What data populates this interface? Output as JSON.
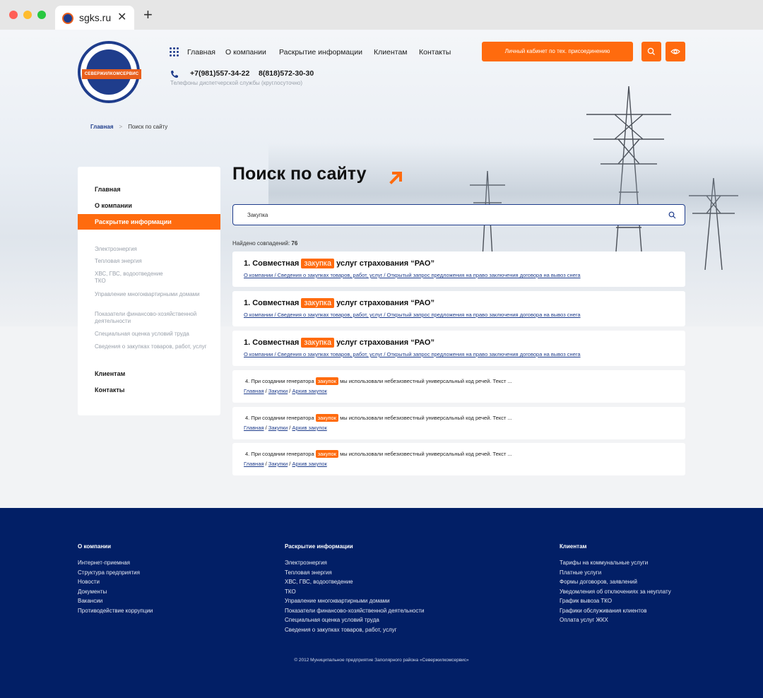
{
  "browser": {
    "tab_title": "sgks.ru",
    "close_glyph": "✕",
    "new_tab_glyph": "+"
  },
  "header": {
    "nav": [
      "Главная",
      "О компании",
      "Раскрытие информации",
      "Клиентам",
      "Контакты"
    ],
    "phones": [
      "+7(981)557-34-22",
      "8(818)572-30-30"
    ],
    "phones_caption": "Телефоны диспетчерской службы (круглосуточно)",
    "cabinet_button": "Личный кабинет по тех. присоединению",
    "logo_band_text": "СЕВЕРЖИЛКОМСЕРВИС"
  },
  "breadcrumb": {
    "home": "Главная",
    "separator": ">",
    "current": "Поиск по сайту"
  },
  "sidebar": {
    "top": [
      "Главная",
      "О компании"
    ],
    "active": "Раскрытие информации",
    "sub": [
      "Электроэнергия",
      "Тепловая энергия",
      "ХВС, ГВС, водоотведение\nТКО",
      "Управление многоквартирными домами",
      "Показатели финансово-хозяйственной деятельности",
      "Специальная оценка условий труда",
      "Сведения о закупках товаров, работ, услуг"
    ],
    "bottom": [
      "Клиентам",
      "Контакты"
    ]
  },
  "search": {
    "page_title": "Поиск по сайту",
    "query": "Закупка",
    "found_label": "Найдено совпадений:",
    "found_count": "76"
  },
  "results_big": [
    {
      "prefix": "1. Совместная",
      "highlight": "закупка",
      "suffix": "услуг страхования “РАО”",
      "path": "О компании / Сведения о закупках товаров, работ, услуг / Открытый запрос предложения на право заключения договора на вывоз снега"
    },
    {
      "prefix": "1. Совместная",
      "highlight": "закупка",
      "suffix": "услуг страхования “РАО”",
      "path": "О компании / Сведения о закупках товаров, работ, услуг / Открытый запрос предложения на право заключения договора на вывоз снега"
    },
    {
      "prefix": "1. Совместная",
      "highlight": "закупка",
      "suffix": "услуг страхования “РАО”",
      "path": "О компании / Сведения о закупках товаров, работ, услуг / Открытый запрос предложения на право заключения договора на вывоз снега"
    }
  ],
  "results_small": [
    {
      "prefix": "4.   При создании генератора",
      "highlight": "закупок",
      "suffix": "мы использовали небезизвестный универсальный код речей. Текст ...",
      "links": [
        "Главная",
        "Закупки",
        "Архив закупок"
      ]
    },
    {
      "prefix": "4.   При создании генератора",
      "highlight": "закупок",
      "suffix": "мы использовали небезизвестный универсальный код речей. Текст ...",
      "links": [
        "Главная",
        "Закупки",
        "Архив закупок"
      ]
    },
    {
      "prefix": "4.   При создании генератора",
      "highlight": "закупок",
      "suffix": "мы использовали небезизвестный универсальный код речей. Текст ...",
      "links": [
        "Главная",
        "Закупки",
        "Архив закупок"
      ]
    }
  ],
  "footer": {
    "col1": {
      "head": "О компании",
      "links": [
        "Интернет-приемная",
        "Структура предприятия",
        "Новости",
        "Документы",
        "Вакансии",
        "Противодействие коррупции"
      ]
    },
    "col2": {
      "head": "Раскрытие информации",
      "links": [
        "Электроэнергия",
        "Тепловая энергия",
        "ХВС, ГВС, водоотведение",
        "ТКО",
        "Управление многоквартирными домами",
        "Показатели финансово-хозяйственной деятельности",
        "Специальная оценка условий труда",
        "Сведения о закупках товаров, работ, услуг"
      ]
    },
    "col3": {
      "head": "Клиентам",
      "links": [
        "Тарифы на коммунальные услуги",
        "Платные услуги",
        "Формы договоров, заявлений",
        "Уведомления об отключениях за неуплату",
        "График вывоза ТКО",
        "Графики обслуживания клиентов",
        "Оплата услуг ЖКХ"
      ]
    },
    "copyright": "© 2012 Муниципальное предприятие Заполярного района «Севержилкомсервис»"
  },
  "colors": {
    "accent": "#ff6b0e",
    "brand": "#1f3d8c",
    "footer_bg": "#021f66"
  },
  "icons": [
    "grid-icon",
    "phone-icon",
    "search-icon",
    "eye-icon",
    "arrow-up-right-icon"
  ]
}
